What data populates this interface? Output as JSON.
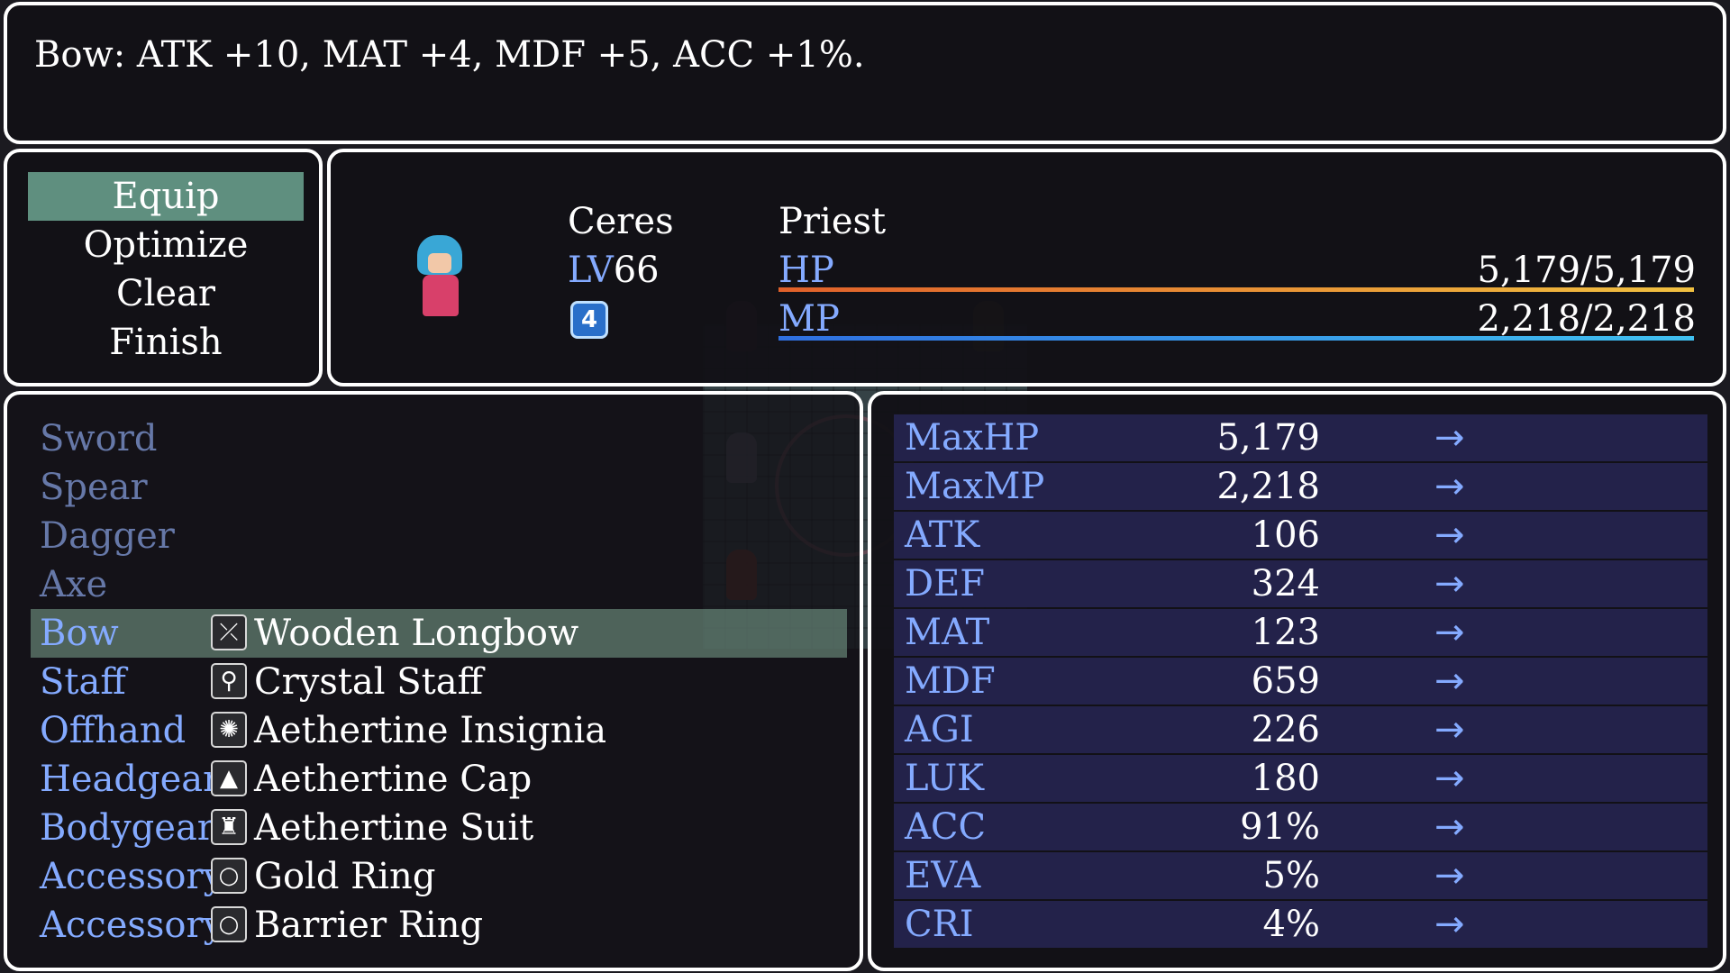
{
  "help": {
    "text": "Bow: ATK +10, MAT +4, MDF +5, ACC +1%."
  },
  "commands": [
    {
      "label": "Equip",
      "selected": true
    },
    {
      "label": "Optimize",
      "selected": false
    },
    {
      "label": "Clear",
      "selected": false
    },
    {
      "label": "Finish",
      "selected": false
    }
  ],
  "actor": {
    "name": "Ceres",
    "class": "Priest",
    "level_label": "LV",
    "level": "66",
    "state_icon": "4",
    "hp_label": "HP",
    "hp": "5,179/5,179",
    "hp_fraction": 1.0,
    "mp_label": "MP",
    "mp": "2,218/2,218",
    "mp_fraction": 1.0
  },
  "colors": {
    "system_text": "#84aaff",
    "highlight": "#5f8f7f",
    "hp_gauge_start": "#e0602a",
    "hp_gauge_end": "#f0c040",
    "mp_gauge_start": "#2f6fe0",
    "mp_gauge_end": "#40c0f0",
    "param_row_bg": "#23224a"
  },
  "slots": [
    {
      "type": "Sword",
      "item": "",
      "icon": "",
      "disabled": true
    },
    {
      "type": "Spear",
      "item": "",
      "icon": "",
      "disabled": true
    },
    {
      "type": "Dagger",
      "item": "",
      "icon": "",
      "disabled": true
    },
    {
      "type": "Axe",
      "item": "",
      "icon": "",
      "disabled": true
    },
    {
      "type": "Bow",
      "item": "Wooden Longbow",
      "icon": "bow-icon",
      "glyph": "⤫",
      "selected": true
    },
    {
      "type": "Staff",
      "item": "Crystal Staff",
      "icon": "staff-icon",
      "glyph": "⚲"
    },
    {
      "type": "Offhand",
      "item": "Aethertine Insignia",
      "icon": "insignia-icon",
      "glyph": "✺"
    },
    {
      "type": "Headgear",
      "item": "Aethertine Cap",
      "icon": "hat-icon",
      "glyph": "▲"
    },
    {
      "type": "Bodygear",
      "item": "Aethertine Suit",
      "icon": "armor-icon",
      "glyph": "♜"
    },
    {
      "type": "Accessory",
      "item": "Gold Ring",
      "icon": "ring-icon",
      "glyph": "○"
    },
    {
      "type": "Accessory",
      "item": "Barrier Ring",
      "icon": "ring-icon",
      "glyph": "○"
    }
  ],
  "params": [
    {
      "name": "MaxHP",
      "value": "5,179"
    },
    {
      "name": "MaxMP",
      "value": "2,218"
    },
    {
      "name": "ATK",
      "value": "106"
    },
    {
      "name": "DEF",
      "value": "324"
    },
    {
      "name": "MAT",
      "value": "123"
    },
    {
      "name": "MDF",
      "value": "659"
    },
    {
      "name": "AGI",
      "value": "226"
    },
    {
      "name": "LUK",
      "value": "180"
    },
    {
      "name": "ACC",
      "value": "91%"
    },
    {
      "name": "EVA",
      "value": "5%"
    },
    {
      "name": "CRI",
      "value": "4%"
    }
  ],
  "param_arrow": "→"
}
